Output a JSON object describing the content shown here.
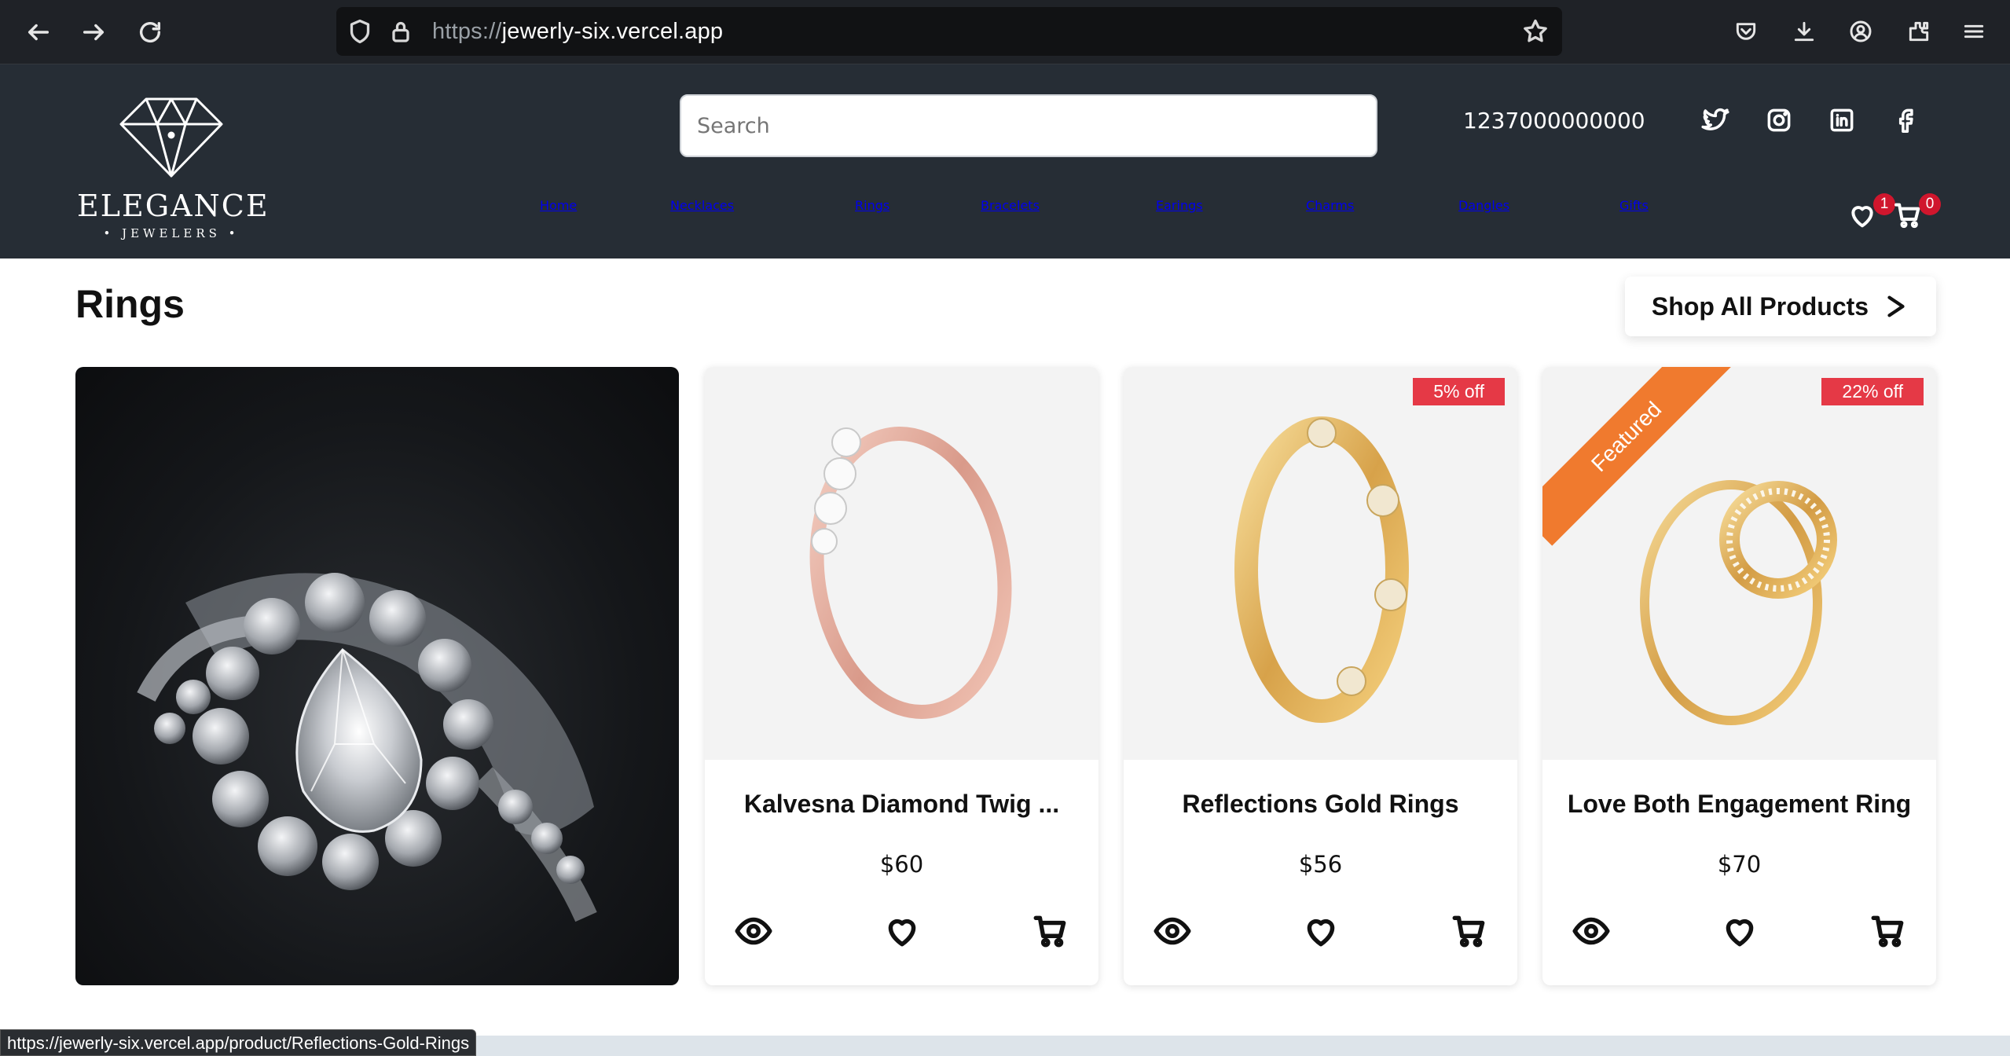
{
  "browser": {
    "url_protocol": "https://",
    "url_host": "jewerly-six.vercel.app",
    "status_url": "https://jewerly-six.vercel.app/product/Reflections-Gold-Rings"
  },
  "header": {
    "logo_name": "ELEGANCE",
    "logo_sub": "• JEWELERS •",
    "search_placeholder": "Search",
    "phone": "1237000000000",
    "nav": [
      "Home",
      "Necklaces",
      "Rings",
      "Bracelets",
      "Earings",
      "Charms",
      "Dangles",
      "Gifts"
    ],
    "wishlist_count": "1",
    "cart_count": "0"
  },
  "section": {
    "title": "Rings",
    "shop_all_label": "Shop All Products"
  },
  "products": [
    {
      "name": "Kalvesna Diamond Twig ...",
      "price": "$60",
      "discount": "",
      "featured": false,
      "metal": "rose"
    },
    {
      "name": "Reflections Gold Rings",
      "price": "$56",
      "discount": "5% off",
      "featured": false,
      "metal": "gold"
    },
    {
      "name": "Love Both Engagement Ring",
      "price": "$70",
      "discount": "22% off",
      "featured": true,
      "featured_label": "Featured",
      "metal": "gold"
    }
  ],
  "colors": {
    "header_bg": "#262d35",
    "badge": "#d0162d",
    "discount": "#e53946",
    "ribbon": "#f07a2e"
  }
}
